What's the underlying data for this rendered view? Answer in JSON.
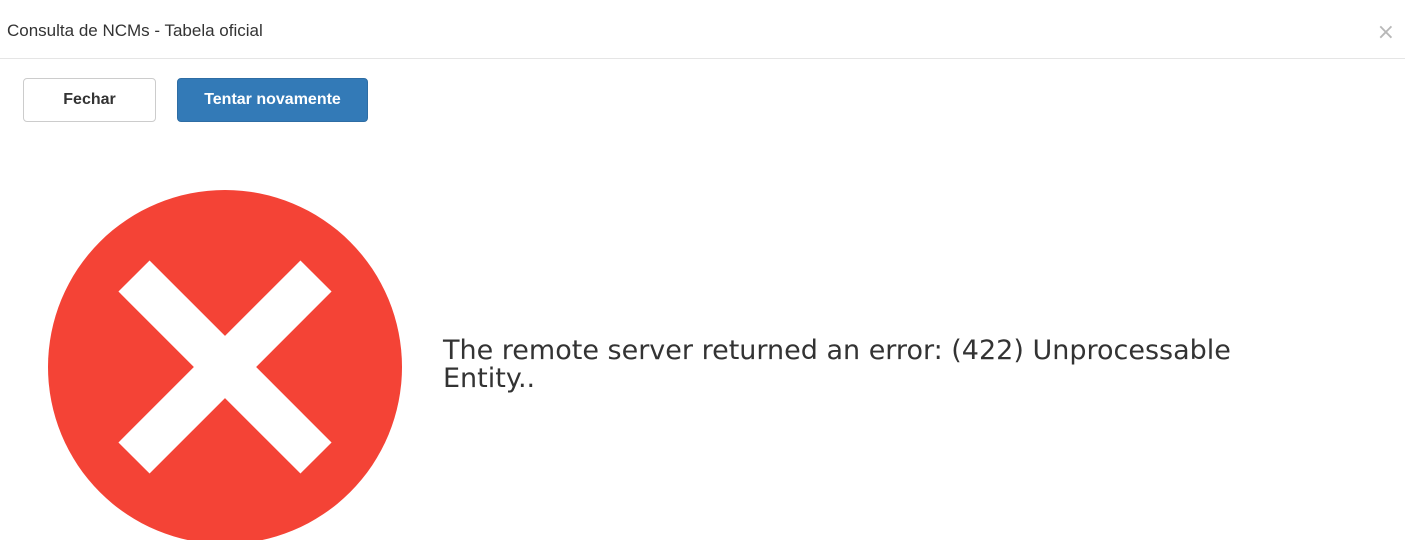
{
  "dialog": {
    "title": "Consulta de NCMs - Tabela oficial",
    "close_glyph": "×"
  },
  "buttons": {
    "close_label": "Fechar",
    "retry_label": "Tentar novamente"
  },
  "error": {
    "icon": "error-x-circle-icon",
    "icon_color": "#f44336",
    "message": "The remote server returned an error: (422) Unprocessable Entity.."
  },
  "colors": {
    "primary": "#337ab7",
    "error": "#f44336"
  }
}
